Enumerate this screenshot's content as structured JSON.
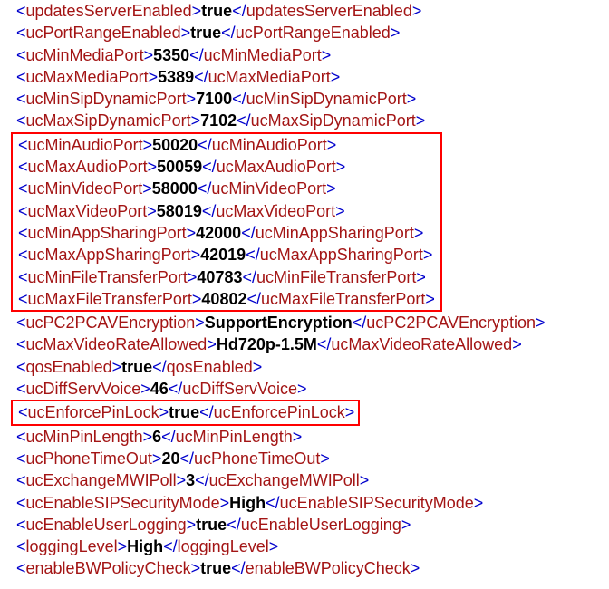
{
  "lines": [
    {
      "tag": "updatesServerEnabled",
      "value": "true"
    },
    {
      "tag": "ucPortRangeEnabled",
      "value": "true"
    },
    {
      "tag": "ucMinMediaPort",
      "value": "5350"
    },
    {
      "tag": "ucMaxMediaPort",
      "value": "5389"
    },
    {
      "tag": "ucMinSipDynamicPort",
      "value": "7100"
    },
    {
      "tag": "ucMaxSipDynamicPort",
      "value": "7102"
    },
    {
      "tag": "ucMinAudioPort",
      "value": "50020",
      "group": "ports"
    },
    {
      "tag": "ucMaxAudioPort",
      "value": "50059",
      "group": "ports"
    },
    {
      "tag": "ucMinVideoPort",
      "value": "58000",
      "group": "ports"
    },
    {
      "tag": "ucMaxVideoPort",
      "value": "58019",
      "group": "ports"
    },
    {
      "tag": "ucMinAppSharingPort",
      "value": "42000",
      "group": "ports"
    },
    {
      "tag": "ucMaxAppSharingPort",
      "value": "42019",
      "group": "ports"
    },
    {
      "tag": "ucMinFileTransferPort",
      "value": "40783",
      "group": "ports"
    },
    {
      "tag": "ucMaxFileTransferPort",
      "value": "40802",
      "group": "ports"
    },
    {
      "tag": "ucPC2PCAVEncryption",
      "value": "SupportEncryption"
    },
    {
      "tag": "ucMaxVideoRateAllowed",
      "value": "Hd720p-1.5M"
    },
    {
      "tag": "qosEnabled",
      "value": "true"
    },
    {
      "tag": "ucDiffServVoice",
      "value": "46"
    },
    {
      "tag": "ucEnforcePinLock",
      "value": "true",
      "group": "pin"
    },
    {
      "tag": "ucMinPinLength",
      "value": "6"
    },
    {
      "tag": "ucPhoneTimeOut",
      "value": "20"
    },
    {
      "tag": "ucExchangeMWIPoll",
      "value": "3"
    },
    {
      "tag": "ucEnableSIPSecurityMode",
      "value": "High"
    },
    {
      "tag": "ucEnableUserLogging",
      "value": "true"
    },
    {
      "tag": "loggingLevel",
      "value": "High"
    },
    {
      "tag": "enableBWPolicyCheck",
      "value": "true"
    }
  ]
}
